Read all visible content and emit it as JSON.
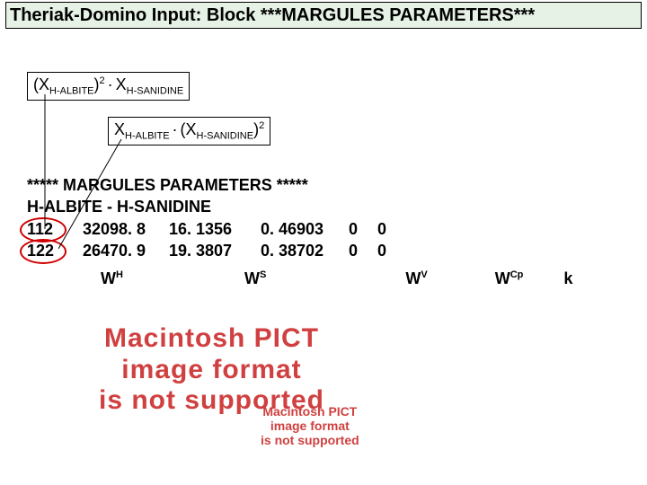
{
  "title": "Theriak-Domino Input: Block ***MARGULES PARAMETERS***",
  "formula1": {
    "open": "(X",
    "sub1": "H-ALBITE",
    "close": ")",
    "sup1": "2",
    "xsub2": "H-SANIDINE"
  },
  "formula2": {
    "sub1": "H-ALBITE",
    "sub2": "H-SANIDINE",
    "sup2": "2"
  },
  "code": {
    "header": "***** MARGULES PARAMETERS *****",
    "pair": "H-ALBITE - H-SANIDINE",
    "rows": [
      {
        "code": "112",
        "wh": "32098. 8",
        "ws": "16. 1356",
        "v3": "0. 46903",
        "v0a": "0",
        "v0b": "0"
      },
      {
        "code": "122",
        "wh": "26470. 9",
        "ws": "19. 3807",
        "v3": "0. 38702",
        "v0a": "0",
        "v0b": "0"
      }
    ]
  },
  "labels": {
    "wh": "W",
    "wh_s": "H",
    "ws": "W",
    "ws_s": "S",
    "wv": "W",
    "wv_s": "V",
    "wcp": "W",
    "wcp_s": "Cp",
    "k": "k"
  },
  "pict_large": {
    "l1": "Macintosh PICT",
    "l2": "image format",
    "l3": "is not supported"
  },
  "pict_small": {
    "l1": "Macintosh PICT",
    "l2": "image format",
    "l3": "is not supported"
  }
}
